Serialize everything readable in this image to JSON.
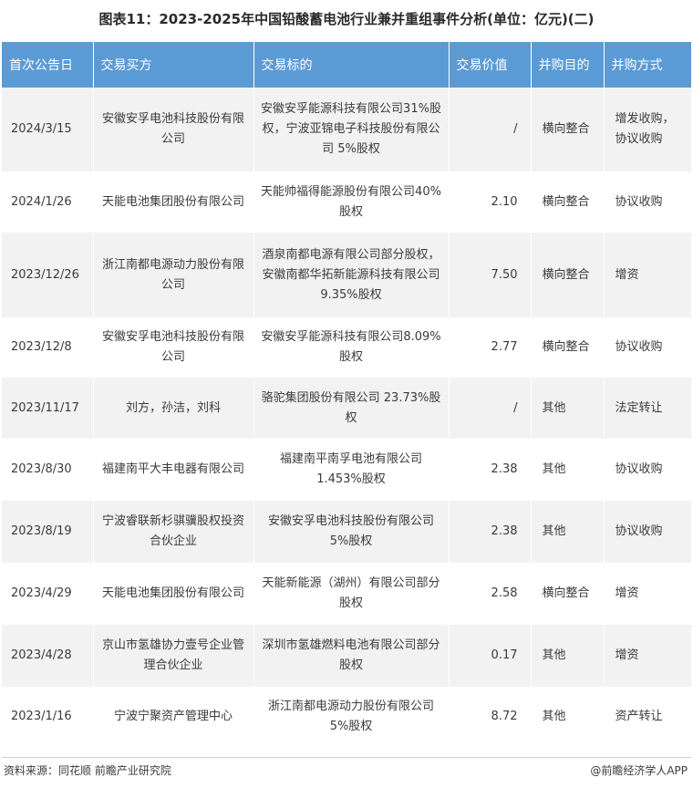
{
  "title": "图表11：2023-2025年中国铅酸蓄电池行业兼并重组事件分析(单位：亿元)(二)",
  "headers": [
    "首次公告日",
    "交易买方",
    "交易标的",
    "交易价值",
    "并购目的",
    "并购方式"
  ],
  "rows": [
    {
      "date": "2024/3/15",
      "buyer": "安徽安孚电池科技股份有限公司",
      "target": "安徽安孚能源科技有限公司31%股权，宁波亚锦电子科技股份有限公司 5%股权",
      "value": "/",
      "purpose": "横向整合",
      "method": "增发收购，协议收购"
    },
    {
      "date": "2024/1/26",
      "buyer": "天能电池集团股份有限公司",
      "target": "天能帅福得能源股份有限公司40%股权",
      "value": "2.10",
      "purpose": "横向整合",
      "method": "协议收购"
    },
    {
      "date": "2023/12/26",
      "buyer": "浙江南都电源动力股份有限公司",
      "target": "酒泉南都电源有限公司部分股权，安徽南都华拓新能源科技有限公司 9.35%股权",
      "value": "7.50",
      "purpose": "横向整合",
      "method": "增资"
    },
    {
      "date": "2023/12/8",
      "buyer": "安徽安孚电池科技股份有限公司",
      "target": "安徽安孚能源科技有限公司8.09%股权",
      "value": "2.77",
      "purpose": "横向整合",
      "method": "协议收购"
    },
    {
      "date": "2023/11/17",
      "buyer": "刘方，孙洁，刘科",
      "target": "骆驼集团股份有限公司 23.73%股权",
      "value": "/",
      "purpose": "其他",
      "method": "法定转让"
    },
    {
      "date": "2023/8/30",
      "buyer": "福建南平大丰电器有限公司",
      "target": "福建南平南孚电池有限公司1.453%股权",
      "value": "2.38",
      "purpose": "其他",
      "method": "协议收购"
    },
    {
      "date": "2023/8/19",
      "buyer": "宁波睿联新杉骐骥股权投资合伙企业",
      "target": "安徽安孚电池科技股份有限公司 5%股权",
      "value": "2.38",
      "purpose": "其他",
      "method": "协议收购"
    },
    {
      "date": "2023/4/29",
      "buyer": "天能电池集团股份有限公司",
      "target": "天能新能源（湖州）有限公司部分股权",
      "value": "2.58",
      "purpose": "横向整合",
      "method": "增资"
    },
    {
      "date": "2023/4/28",
      "buyer": "京山市氢雄协力壹号企业管理合伙企业",
      "target": "深圳市氢雄燃料电池有限公司部分股权",
      "value": "0.17",
      "purpose": "其他",
      "method": "增资"
    },
    {
      "date": "2023/1/16",
      "buyer": "宁波宁聚资产管理中心",
      "target": "浙江南都电源动力股份有限公司 5%股权",
      "value": "8.72",
      "purpose": "其他",
      "method": "资产转让"
    }
  ],
  "footer": {
    "source": "资料来源：同花顺 前瞻产业研究院",
    "brand": "@前瞻经济学人APP"
  }
}
